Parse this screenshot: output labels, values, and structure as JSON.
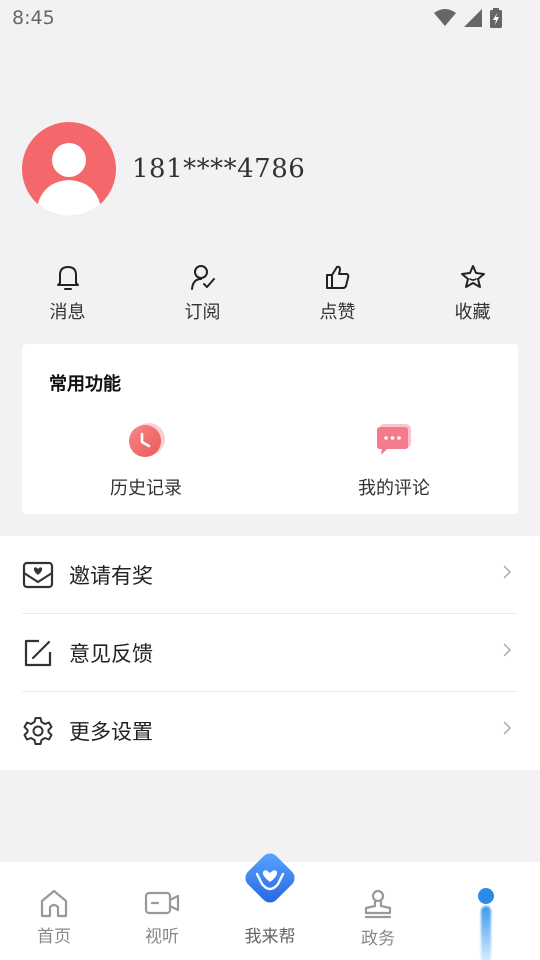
{
  "status_bar": {
    "time": "8:45"
  },
  "profile": {
    "phone": "181****4786"
  },
  "quick_actions": [
    {
      "icon": "bell-icon",
      "label": "消息"
    },
    {
      "icon": "user-check-icon",
      "label": "订阅"
    },
    {
      "icon": "thumbs-up-icon",
      "label": "点赞"
    },
    {
      "icon": "star-icon",
      "label": "收藏"
    }
  ],
  "common_functions": {
    "title": "常用功能",
    "items": [
      {
        "icon": "history-clock-icon",
        "label": "历史记录"
      },
      {
        "icon": "comment-bubble-icon",
        "label": "我的评论"
      }
    ]
  },
  "menu": [
    {
      "icon": "invite-envelope-icon",
      "label": "邀请有奖"
    },
    {
      "icon": "feedback-edit-icon",
      "label": "意见反馈"
    },
    {
      "icon": "settings-gear-icon",
      "label": "更多设置"
    }
  ],
  "tabbar": [
    {
      "icon": "home-icon",
      "label": "首页"
    },
    {
      "icon": "video-camera-icon",
      "label": "视听"
    },
    {
      "icon": "heart-hands-icon",
      "label": "我来帮"
    },
    {
      "icon": "stamp-icon",
      "label": "政务"
    },
    {
      "icon": "profile-icon",
      "label": ""
    }
  ],
  "colors": {
    "avatar": "#f4686b",
    "accent_blue": "#2b8ae8",
    "history_icon": "#f26060",
    "comment_icon": "#f47a8c"
  }
}
